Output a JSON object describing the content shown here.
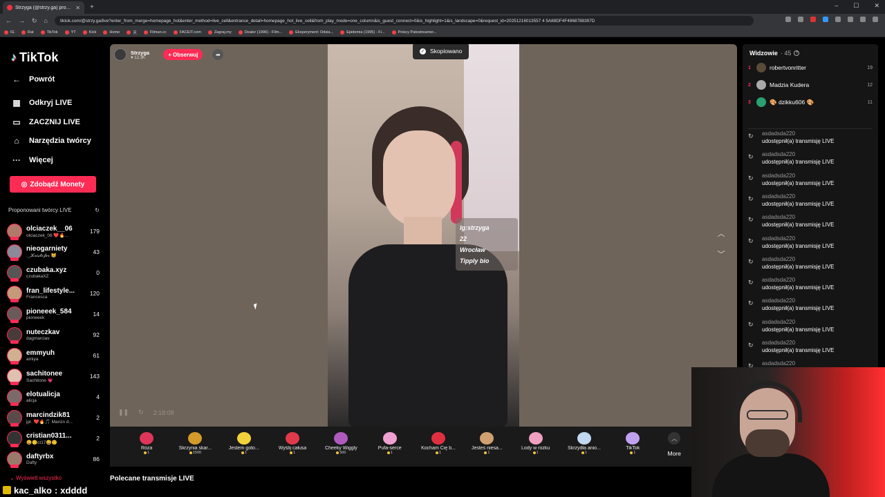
{
  "browser": {
    "tab_title": "Strzyga (@strzy.ga) prowadz...",
    "url": "tiktok.com/@strzy.ga/live?enter_from_merge=homepage_hot&enter_method=live_cell&entrance_detail=homepage_hot_live_cell&from_play_mode=one_column&is_guest_connect=0&is_highlight=1&is_landscape=0&request_id=20251216013557 4 5A88DF4F4968788397D",
    "bookmarks": [
      "IG",
      "Rat",
      "TikTok",
      "YT",
      "Kick",
      "Home",
      "天",
      "Filman.cc",
      "FACEIT.com",
      "Zagraj.my",
      "Dealer (1996) - Film...",
      "Eksperyment: Odsia...",
      "Epidemia (1995) - Fi...",
      "Polscy Patostreamer..."
    ]
  },
  "sidebar": {
    "logo": "TikTok",
    "menu": [
      {
        "label": "Powrót",
        "icon": "back-arrow-icon"
      },
      {
        "label": "Odkryj LIVE",
        "icon": "calendar-icon"
      },
      {
        "label": "ZACZNIJ LIVE",
        "icon": "video-camera-icon"
      },
      {
        "label": "Narzędzia twórcy",
        "icon": "lightbulb-icon"
      },
      {
        "label": "Więcej",
        "icon": "more-dots-icon"
      }
    ],
    "coins_button": "Zdobądź Monety",
    "suggested_title": "Proponowani twórcy LIVE",
    "creators": [
      {
        "name": "olciaczek__06",
        "sub": "olciaczek_06 ❤️🔥...",
        "count": "179",
        "color": "#b07a6a"
      },
      {
        "name": "nieogarniety",
        "sub": "._𝓚𝓻𝓲𝓼𝓽𝓸𝓯𝓮𝓻 😸",
        "count": "43",
        "color": "#8a8a9a"
      },
      {
        "name": "czubaka.xyz",
        "sub": "czubakaXZ",
        "count": "0",
        "color": "#555"
      },
      {
        "name": "fran_lifestyle...",
        "sub": "Francesca",
        "count": "120",
        "color": "#c49a7a"
      },
      {
        "name": "pioneeek_584",
        "sub": "pioneeek",
        "count": "14",
        "color": "#6a5a5a"
      },
      {
        "name": "nuteczkav",
        "sub": "dagmarciav",
        "count": "92",
        "color": "#4a3a3a"
      },
      {
        "name": "emmyuh",
        "sub": "amiya",
        "count": "61",
        "color": "#d0b090"
      },
      {
        "name": "sachitonee",
        "sub": "Sachitone 💗",
        "count": "143",
        "color": "#e0c0b0"
      },
      {
        "name": "elotualicja",
        "sub": "alicja",
        "count": "4",
        "color": "#7a6a6a"
      },
      {
        "name": "marcindzik81",
        "sub": "jpr. ❤️🔥🎵 Marcin d...",
        "count": "2",
        "color": "#5a4a4a"
      },
      {
        "name": "cristian0311...",
        "sub": "😀🙂ct17😀🙂",
        "count": "2",
        "color": "#333"
      },
      {
        "name": "daftyrbx",
        "sub": "Dafty",
        "count": "86",
        "color": "#9a7a6a"
      }
    ],
    "show_all": "Wyświetl wszystko"
  },
  "stream": {
    "host_name": "Strzyga",
    "host_followers": "12.3K",
    "follow_label": "+ Obserwuj",
    "copied_toast": "Skopiowano",
    "overlay_lines": [
      "Ig:strzyga",
      "22",
      "Wrocław",
      "Tipply bio"
    ],
    "time": "2:18:08"
  },
  "gifts": [
    {
      "name": "Róża",
      "price": "1",
      "color": "#e0355a"
    },
    {
      "name": "Skrzynia skar...",
      "price": "1500",
      "color": "#d49a2a"
    },
    {
      "name": "Jestem goto...",
      "price": "1",
      "color": "#f2d23a"
    },
    {
      "name": "Wyślij całusa",
      "price": "1",
      "color": "#e03a4a"
    },
    {
      "name": "Cheeky Wiggly",
      "price": "500",
      "color": "#b05ac0"
    },
    {
      "name": "Pufa-serce",
      "price": "1",
      "color": "#f0a0d0"
    },
    {
      "name": "Kocham Cię b...",
      "price": "1",
      "color": "#e03040"
    },
    {
      "name": "Jesteś niesa...",
      "price": "1",
      "color": "#d0a070"
    },
    {
      "name": "Lody w rożku",
      "price": "1",
      "color": "#f0a0c0"
    },
    {
      "name": "Skrzydła anio...",
      "price": "1",
      "color": "#c0d8f0"
    },
    {
      "name": "TikTok",
      "price": "1",
      "color": "#c0a0f0"
    }
  ],
  "more_label": "More",
  "recommended_title": "Polecane transmisje LIVE",
  "viewers": {
    "title": "Widzowie",
    "count": "· 45",
    "list": [
      {
        "rank": "1",
        "name": "robertvonritter",
        "score": "19",
        "color": "#5a4a3a"
      },
      {
        "rank": "2",
        "name": "Madzia Kudera",
        "score": "12",
        "color": "#aaa"
      },
      {
        "rank": "3",
        "name": "🎨 dzikku606 🎨",
        "score": "11",
        "color": "#2aa070"
      }
    ]
  },
  "chat": {
    "messages": [
      {
        "user": "asdadsda220",
        "text": "udostępnił(a) transmisję LIVE"
      },
      {
        "user": "asdadsda220",
        "text": "udostępnił(a) transmisję LIVE"
      },
      {
        "user": "asdadsda220",
        "text": "udostępnił(a) transmisję LIVE"
      },
      {
        "user": "asdadsda220",
        "text": "udostępnił(a) transmisję LIVE"
      },
      {
        "user": "asdadsda220",
        "text": "udostępnił(a) transmisję LIVE"
      },
      {
        "user": "asdadsda220",
        "text": "udostępnił(a) transmisję LIVE"
      },
      {
        "user": "asdadsda220",
        "text": "udostępnił(a) transmisję LIVE"
      },
      {
        "user": "asdadsda220",
        "text": "udostępnił(a) transmisję LIVE"
      },
      {
        "user": "asdadsda220",
        "text": "udostępnił(a) transmisję LIVE"
      },
      {
        "user": "asdadsda220",
        "text": "udostępnił(a) transmisję LIVE"
      },
      {
        "user": "asdadsda220",
        "text": "udostępnił(a) transmisję LIVE"
      },
      {
        "user": "asdadsda220",
        "text": ""
      }
    ]
  },
  "overlay_chat": {
    "user": "kac_alko",
    "text": "xdddd"
  }
}
